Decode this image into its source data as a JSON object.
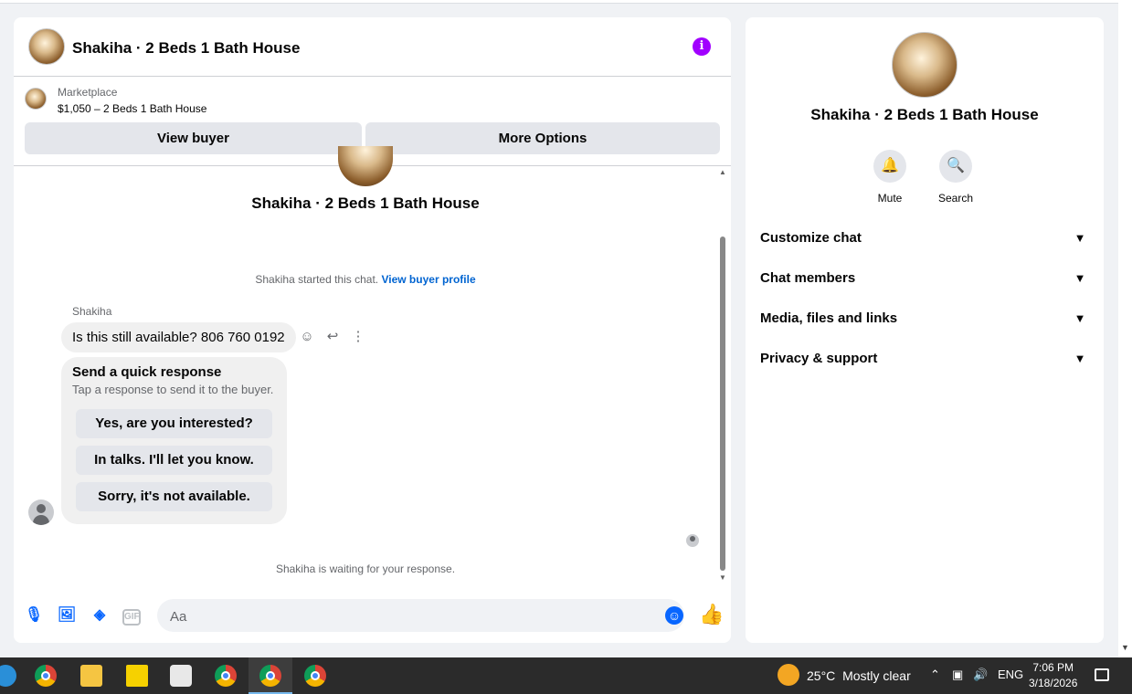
{
  "chat": {
    "title": "Shakiha · 2 Beds 1 Bath House",
    "listing_source": "Marketplace",
    "listing_title": "$1,050 – 2 Beds 1 Bath House",
    "view_buyer": "View buyer",
    "more_options": "More Options",
    "conversation_title": "Shakiha · 2 Beds 1 Bath House",
    "started_text": "Shakiha started this chat.",
    "started_link": "View buyer profile",
    "sender_name": "Shakiha",
    "message": "Is this still available? 806 760 0192",
    "quick_title": "Send a quick response",
    "quick_sub": "Tap a response to send it to the buyer.",
    "quick_replies": [
      "Yes, are you interested?",
      "In talks. I'll let you know.",
      "Sorry, it's not available."
    ],
    "waiting": "Shakiha is waiting for your response.",
    "input_placeholder": "Aa",
    "gif_label": "GIF"
  },
  "side": {
    "title": "Shakiha · 2 Beds 1 Bath House",
    "mute_label": "Mute",
    "search_label": "Search",
    "menu": [
      "Customize chat",
      "Chat members",
      "Media, files and links",
      "Privacy & support"
    ]
  },
  "taskbar": {
    "weather_temp": "25°C",
    "weather_desc": "Mostly clear",
    "language": "ENG",
    "time": "7:06 PM",
    "date": "3/18/2026"
  },
  "colors": {
    "accent": "#0866ff",
    "info": "#a100ff",
    "link": "#0064d1"
  }
}
